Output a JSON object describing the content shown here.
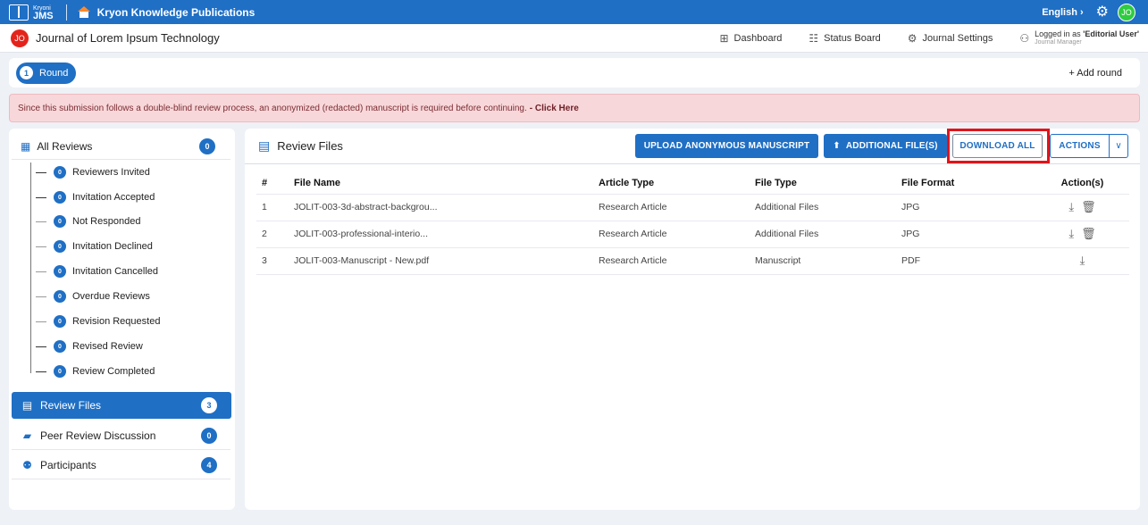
{
  "topbar": {
    "brand_small": "Kryoni",
    "brand_big": "JMS",
    "site_title": "Kryon Knowledge Publications",
    "language": "English",
    "language_arrow": "›",
    "avatar_initials": "JO"
  },
  "journalbar": {
    "badge": "JO",
    "title": "Journal of Lorem Ipsum Technology",
    "nav": {
      "dashboard": "Dashboard",
      "status_board": "Status Board",
      "journal_settings": "Journal Settings"
    },
    "logged_prefix": "Logged in as ",
    "logged_role": "'Editorial User'",
    "logged_sub": "Journal Manager"
  },
  "round": {
    "number": "1",
    "label": "Round",
    "add_label": "+ Add round"
  },
  "alert": {
    "text": "Since this submission follows a double-blind review process, an anonymized (redacted) manuscript is required before continuing. ",
    "link": "- Click Here"
  },
  "sidebar": {
    "all_reviews": {
      "label": "All Reviews",
      "count": "0"
    },
    "sub_items": [
      {
        "label": "Reviewers Invited",
        "count": "0"
      },
      {
        "label": "Invitation Accepted",
        "count": "0"
      },
      {
        "label": "Not Responded",
        "count": "0"
      },
      {
        "label": "Invitation Declined",
        "count": "0"
      },
      {
        "label": "Invitation Cancelled",
        "count": "0"
      },
      {
        "label": "Overdue Reviews",
        "count": "0"
      },
      {
        "label": "Revision Requested",
        "count": "0"
      },
      {
        "label": "Revised Review",
        "count": "0"
      },
      {
        "label": "Review Completed",
        "count": "0"
      }
    ],
    "review_files": {
      "label": "Review Files",
      "count": "3"
    },
    "peer_discussion": {
      "label": "Peer Review Discussion",
      "count": "0"
    },
    "participants": {
      "label": "Participants",
      "count": "4"
    }
  },
  "main": {
    "title": "Review Files",
    "buttons": {
      "upload": "UPLOAD ANONYMOUS MANUSCRIPT",
      "additional": "ADDITIONAL FILE(S)",
      "download_all": "DOWNLOAD ALL",
      "actions": "ACTIONS"
    },
    "columns": [
      "#",
      "File Name",
      "Article Type",
      "File Type",
      "File Format",
      "Action(s)"
    ],
    "rows": [
      {
        "num": "1",
        "name": "JOLIT-003-3d-abstract-backgrou...",
        "article_type": "Research Article",
        "file_type": "Additional Files",
        "format": "JPG"
      },
      {
        "num": "2",
        "name": "JOLIT-003-professional-interio...",
        "article_type": "Research Article",
        "file_type": "Additional Files",
        "format": "JPG"
      },
      {
        "num": "3",
        "name": "JOLIT-003-Manuscript - New.pdf",
        "article_type": "Research Article",
        "file_type": "Manuscript",
        "format": "PDF"
      }
    ]
  },
  "colors": {
    "brand_blue": "#1f6fc5",
    "alert_bg": "#f8d7da",
    "highlight_red": "#e0141b",
    "avatar_green": "#2ecc40",
    "badge_red": "#e3241c"
  }
}
